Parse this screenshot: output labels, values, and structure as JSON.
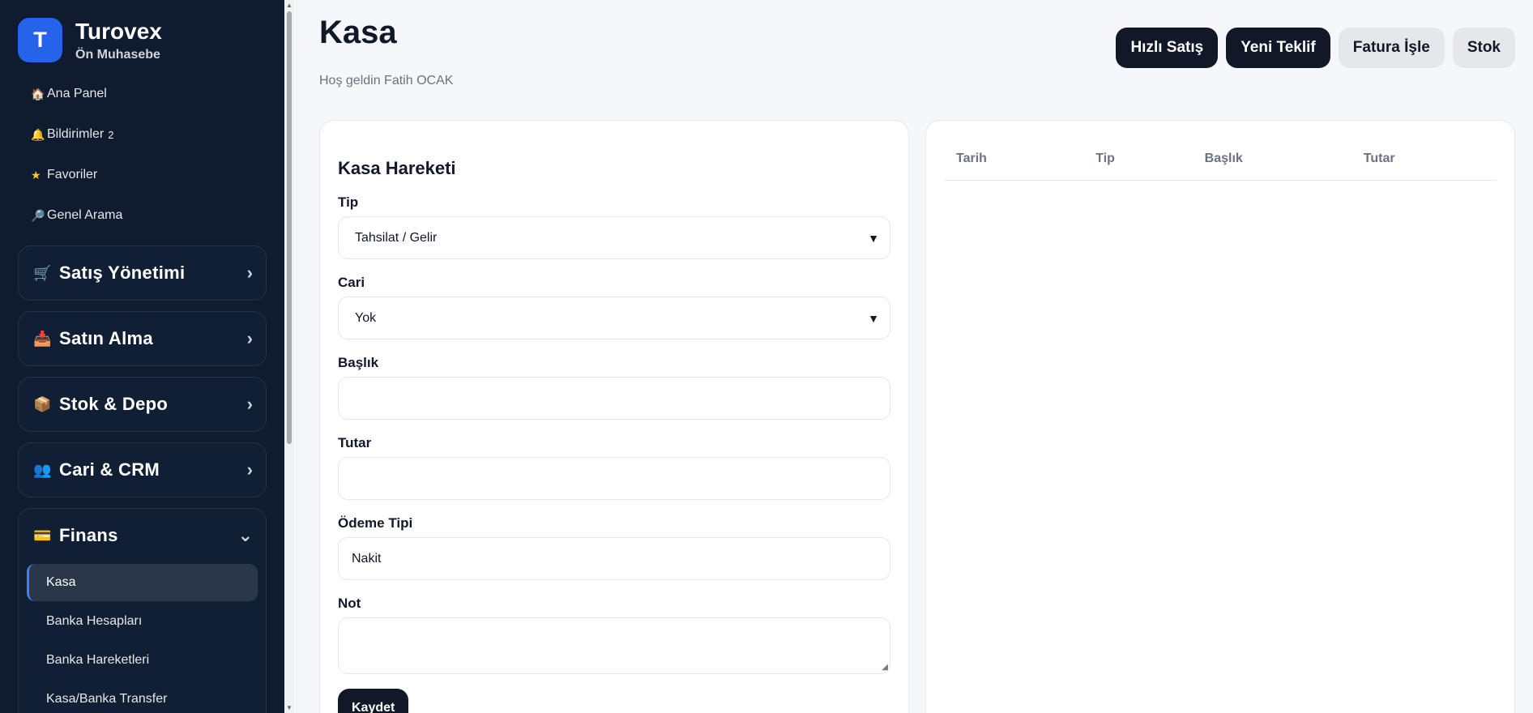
{
  "brand": {
    "logo_letter": "T",
    "name": "Turovex",
    "subtitle": "Ön Muhasebe",
    "logo_color": "#2563eb"
  },
  "sidebar": {
    "top_links": [
      {
        "icon": "house-icon",
        "glyph": "🏠",
        "label": "Ana Panel"
      },
      {
        "icon": "bell-icon",
        "glyph": "🔔",
        "label": "Bildirimler",
        "badge": "2"
      },
      {
        "icon": "star-icon",
        "glyph": "★",
        "label": "Favoriler"
      },
      {
        "icon": "magnifier-icon",
        "glyph": "🔎",
        "label": "Genel Arama"
      }
    ],
    "groups": [
      {
        "icon": "cart-icon",
        "glyph": "🛒",
        "label": "Satış Yönetimi",
        "chevron": "›"
      },
      {
        "icon": "inbox-icon",
        "glyph": "📥",
        "label": "Satın Alma",
        "chevron": "›"
      },
      {
        "icon": "package-icon",
        "glyph": "📦",
        "label": "Stok & Depo",
        "chevron": "›"
      },
      {
        "icon": "people-icon",
        "glyph": "👥",
        "label": "Cari & CRM",
        "chevron": "›"
      },
      {
        "icon": "card-icon",
        "glyph": "💳",
        "label": "Finans",
        "chevron": "⌄",
        "items": [
          "Kasa",
          "Banka Hesapları",
          "Banka Hareketleri",
          "Kasa/Banka Transfer"
        ],
        "active_item": "Kasa"
      }
    ]
  },
  "header": {
    "title": "Kasa",
    "welcome": "Hoş geldin Fatih OCAK",
    "actions": [
      {
        "label": "Hızlı Satış",
        "style": "dark"
      },
      {
        "label": "Yeni Teklif",
        "style": "dark"
      },
      {
        "label": "Fatura İşle",
        "style": "light"
      },
      {
        "label": "Stok",
        "style": "light"
      }
    ]
  },
  "form": {
    "title": "Kasa Hareketi",
    "fields": {
      "tip": {
        "label": "Tip",
        "value": "Tahsilat / Gelir"
      },
      "cari": {
        "label": "Cari",
        "value": "Yok"
      },
      "baslik": {
        "label": "Başlık",
        "value": ""
      },
      "tutar": {
        "label": "Tutar",
        "value": ""
      },
      "odeme_tipi": {
        "label": "Ödeme Tipi",
        "value": "Nakit"
      },
      "not": {
        "label": "Not",
        "value": ""
      }
    },
    "save_label": "Kaydet"
  },
  "table": {
    "columns": [
      "Tarih",
      "Tip",
      "Başlık",
      "Tutar"
    ],
    "rows": []
  },
  "colors": {
    "sidebar_bg": "#0f1b2e",
    "accent": "#2563eb",
    "dark_button": "#111827"
  }
}
